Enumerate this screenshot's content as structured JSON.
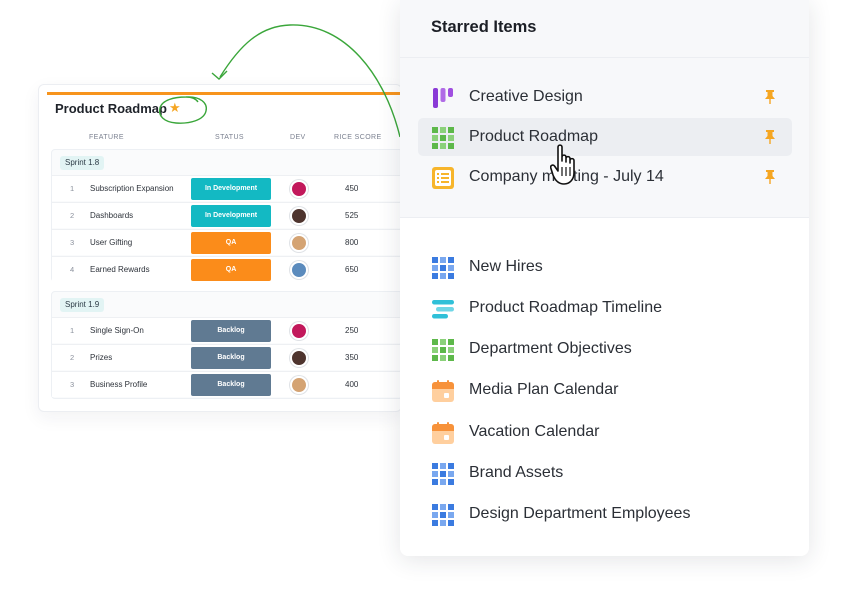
{
  "roadmap": {
    "title": "Product Roadmap",
    "columns": {
      "feature": "FEATURE",
      "status": "STATUS",
      "dev": "DEV",
      "rice": "RICE SCORE"
    },
    "sprints": [
      {
        "name": "Sprint 1.8",
        "rows": [
          {
            "num": "1",
            "feature": "Subscription Expansion",
            "status": "In Development",
            "status_color": "#13b9c3",
            "score": "450",
            "avatar_color": "#c2185b"
          },
          {
            "num": "2",
            "feature": "Dashboards",
            "status": "In Development",
            "status_color": "#13b9c3",
            "score": "525",
            "avatar_color": "#4e342e"
          },
          {
            "num": "3",
            "feature": "User Gifting",
            "status": "QA",
            "status_color": "#fb8c1a",
            "score": "800",
            "avatar_color": "#d4a373"
          },
          {
            "num": "4",
            "feature": "Earned Rewards",
            "status": "QA",
            "status_color": "#fb8c1a",
            "score": "650",
            "avatar_color": "#5b8bbd"
          }
        ]
      },
      {
        "name": "Sprint 1.9",
        "rows": [
          {
            "num": "1",
            "feature": "Single Sign-On",
            "status": "Backlog",
            "status_color": "#607a92",
            "score": "250",
            "avatar_color": "#c2185b"
          },
          {
            "num": "2",
            "feature": "Prizes",
            "status": "Backlog",
            "status_color": "#607a92",
            "score": "350",
            "avatar_color": "#4e342e"
          },
          {
            "num": "3",
            "feature": "Business Profile",
            "status": "Backlog",
            "status_color": "#607a92",
            "score": "400",
            "avatar_color": "#d4a373"
          }
        ]
      }
    ]
  },
  "panel": {
    "title": "Starred Items",
    "starred": [
      {
        "label": "Creative Design",
        "icon": "kanban-icon"
      },
      {
        "label": "Product Roadmap",
        "icon": "grid-green-icon"
      },
      {
        "label": "Company meeting - July 14",
        "icon": "form-icon"
      }
    ],
    "others": [
      {
        "label": "New Hires",
        "icon": "grid-blue-icon"
      },
      {
        "label": "Product Roadmap Timeline",
        "icon": "timeline-icon"
      },
      {
        "label": "Department Objectives",
        "icon": "grid-green-icon"
      },
      {
        "label": "Media Plan Calendar",
        "icon": "calendar-icon"
      },
      {
        "label": "Vacation Calendar",
        "icon": "calendar-icon"
      },
      {
        "label": "Brand Assets",
        "icon": "grid-blue-icon"
      },
      {
        "label": "Design Department Employees",
        "icon": "grid-blue-icon"
      }
    ]
  },
  "colors": {
    "accent_orange": "#f7941d",
    "star": "#f5a623",
    "pin": "#f5a623",
    "annotation_green": "#3aa63a"
  }
}
